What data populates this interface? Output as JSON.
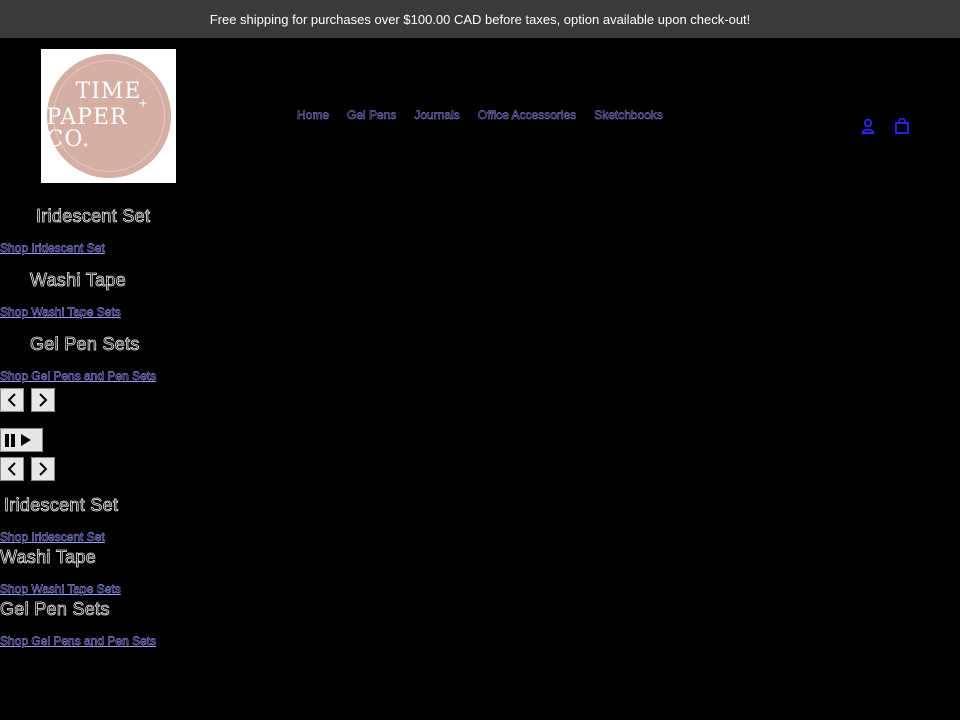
{
  "announcement": "Free shipping for purchases over $100.00 CAD before taxes, option available upon check-out!",
  "logo": {
    "line1": "TIME",
    "plus": "+",
    "line2": "PAPER CO."
  },
  "nav": [
    "Home",
    "Gel Pens",
    "Journals",
    "Office Accessories",
    "Sketchbooks"
  ],
  "header_icons": {
    "account": "user-icon",
    "cart": "bag-icon"
  },
  "slideshow_1": [
    {
      "title": "Iridescent Set",
      "link": "Shop Iridescent Set"
    },
    {
      "title": "Washi Tape",
      "link": "Shop Washi Tape Sets"
    },
    {
      "title": "Gel Pen Sets",
      "link": "Shop Gel Pens and Pen Sets"
    }
  ],
  "slideshow_2": [
    {
      "title": "Iridescent Set",
      "link": "Shop Iridescent Set"
    },
    {
      "title": "Washi Tape",
      "link": "Shop Washi Tape Sets"
    },
    {
      "title": "Gel Pen Sets",
      "link": "Shop Gel Pens and Pen Sets"
    }
  ],
  "colors": {
    "announcement_bg": "#3a3a3a",
    "page_bg": "#000000",
    "logo_circle": "#d5aea4",
    "link": "#3a2fd0"
  }
}
